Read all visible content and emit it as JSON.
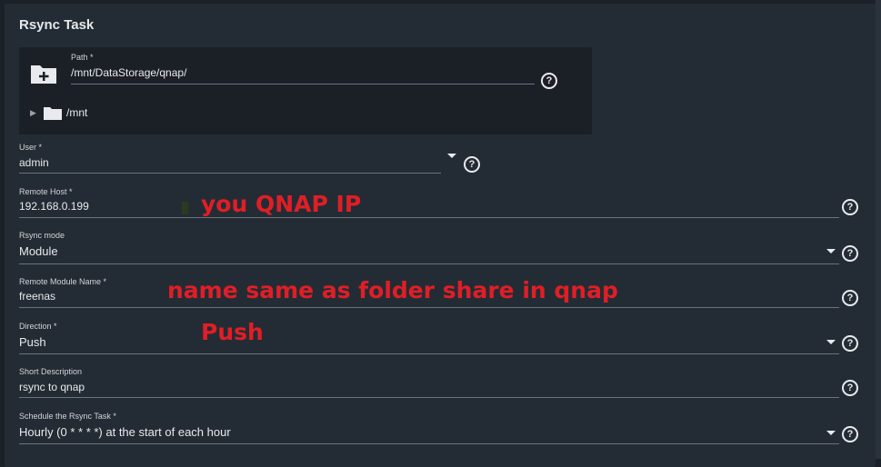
{
  "title": "Rsync Task",
  "path": {
    "label": "Path *",
    "value": "/mnt/DataStorage/qnap/",
    "tree_root": "/mnt"
  },
  "fields": {
    "user": {
      "label": "User *",
      "value": "admin"
    },
    "remote_host": {
      "label": "Remote Host *",
      "value": "192.168.0.199"
    },
    "rsync_mode": {
      "label": "Rsync mode",
      "value": "Module"
    },
    "remote_module": {
      "label": "Remote Module Name *",
      "value": "freenas"
    },
    "direction": {
      "label": "Direction *",
      "value": "Push"
    },
    "short_description": {
      "label": "Short Description",
      "value": "rsync to qnap"
    },
    "schedule": {
      "label": "Schedule the Rsync Task *",
      "value": "Hourly (0 * * * *) at the start of each hour"
    }
  },
  "annotations": {
    "host_note": "you QNAP IP",
    "module_note": "name same as folder share in qnap",
    "direction_note": "Push"
  },
  "help_glyph": "?",
  "colors": {
    "background": "#1b2128",
    "panel": "#232c35",
    "annotation": "#e01e26"
  }
}
